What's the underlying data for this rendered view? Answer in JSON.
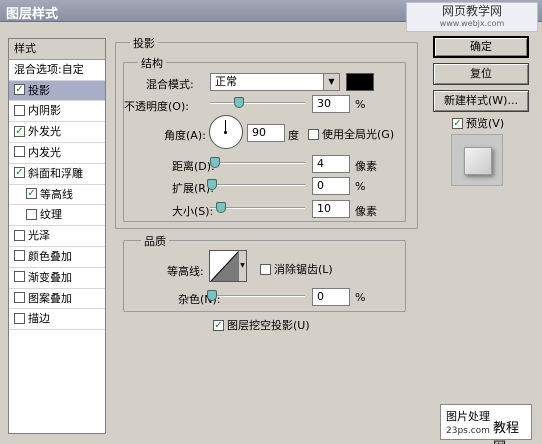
{
  "window": {
    "title": "图层样式",
    "watermark_line1": "网页教学网",
    "watermark_line2": "www.webjx.com"
  },
  "styles_panel": {
    "header": "样式",
    "blend_options": "混合选项:自定",
    "items": [
      {
        "label": "投影",
        "checked": true,
        "selected": true,
        "indent": false
      },
      {
        "label": "内阴影",
        "checked": false,
        "selected": false,
        "indent": false
      },
      {
        "label": "外发光",
        "checked": true,
        "selected": false,
        "indent": false
      },
      {
        "label": "内发光",
        "checked": false,
        "selected": false,
        "indent": false
      },
      {
        "label": "斜面和浮雕",
        "checked": true,
        "selected": false,
        "indent": false
      },
      {
        "label": "等高线",
        "checked": true,
        "selected": false,
        "indent": true
      },
      {
        "label": "纹理",
        "checked": false,
        "selected": false,
        "indent": true
      },
      {
        "label": "光泽",
        "checked": false,
        "selected": false,
        "indent": false
      },
      {
        "label": "颜色叠加",
        "checked": false,
        "selected": false,
        "indent": false
      },
      {
        "label": "渐变叠加",
        "checked": false,
        "selected": false,
        "indent": false
      },
      {
        "label": "图案叠加",
        "checked": false,
        "selected": false,
        "indent": false
      },
      {
        "label": "描边",
        "checked": false,
        "selected": false,
        "indent": false
      }
    ]
  },
  "drop_shadow": {
    "group_title": "投影",
    "structure_title": "结构",
    "blend_mode_label": "混合模式:",
    "blend_mode_value": "正常",
    "shadow_color": "#000000",
    "opacity_label": "不透明度(O):",
    "opacity_value": "30",
    "opacity_unit": "%",
    "angle_label": "角度(A):",
    "angle_value": "90",
    "angle_unit": "度",
    "global_light_label": "使用全局光(G)",
    "distance_label": "距离(D):",
    "distance_value": "4",
    "distance_unit": "像素",
    "spread_label": "扩展(R):",
    "spread_value": "0",
    "spread_unit": "%",
    "size_label": "大小(S):",
    "size_value": "10",
    "size_unit": "像素",
    "quality_title": "品质",
    "contour_label": "等高线:",
    "antialias_label": "消除锯齿(L)",
    "noise_label": "杂色(N):",
    "noise_value": "0",
    "noise_unit": "%",
    "knockout_label": "图层挖空投影(U)"
  },
  "buttons": {
    "ok": "确定",
    "reset": "复位",
    "new_style": "新建样式(W)...",
    "preview": "预览(V)"
  },
  "footer": {
    "line1": "图片处理",
    "line2": "23ps.com",
    "line3": "教程网"
  }
}
